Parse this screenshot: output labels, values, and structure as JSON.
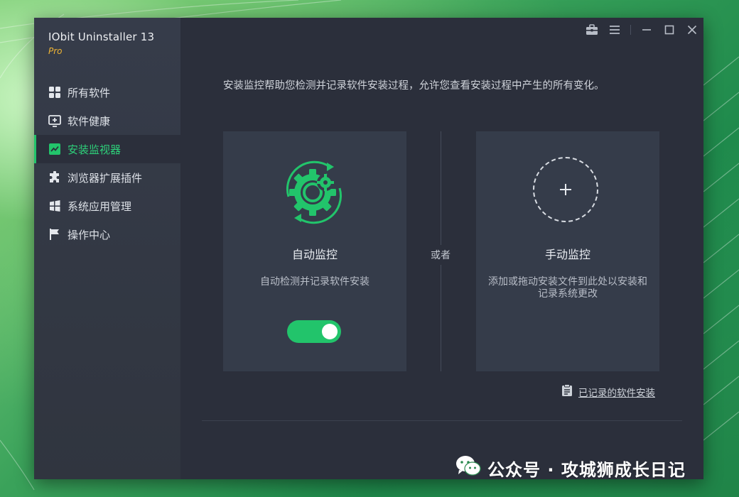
{
  "app": {
    "title": "IObit Uninstaller 13",
    "edition": "Pro"
  },
  "sidebar": {
    "items": [
      {
        "label": "所有软件",
        "icon": "grid-icon",
        "active": false
      },
      {
        "label": "软件健康",
        "icon": "monitor-plus-icon",
        "active": false
      },
      {
        "label": "安装监视器",
        "icon": "trend-chart-icon",
        "active": true
      },
      {
        "label": "浏览器扩展插件",
        "icon": "puzzle-icon",
        "active": false
      },
      {
        "label": "系统应用管理",
        "icon": "windows-icon",
        "active": false
      },
      {
        "label": "操作中心",
        "icon": "flag-icon",
        "active": false
      }
    ]
  },
  "titlebar": {
    "icons": [
      "toolbox-icon",
      "menu-icon",
      "minimize-icon",
      "maximize-icon",
      "close-icon"
    ]
  },
  "main": {
    "intro": "安装监控帮助您检测并记录软件安装过程，允许您查看安装过程中产生的所有变化。",
    "auto": {
      "title": "自动监控",
      "desc": "自动检测并记录软件安装",
      "toggle_on": true
    },
    "or": "或者",
    "manual": {
      "title": "手动监控",
      "desc": "添加或拖动安装文件到此处以安装和记录系统更改",
      "icon": "plus-icon"
    },
    "recorded_link": "已记录的软件安装"
  },
  "watermark": {
    "text": "公众号 · 攻城狮成长日记",
    "icon": "wechat-icon"
  },
  "colors": {
    "accent": "#22c46b",
    "brand_sub": "#f2b634",
    "window_bg": "#2b2f3b",
    "sidebar_bg": "#363c4a",
    "card_bg": "#353c4a"
  }
}
